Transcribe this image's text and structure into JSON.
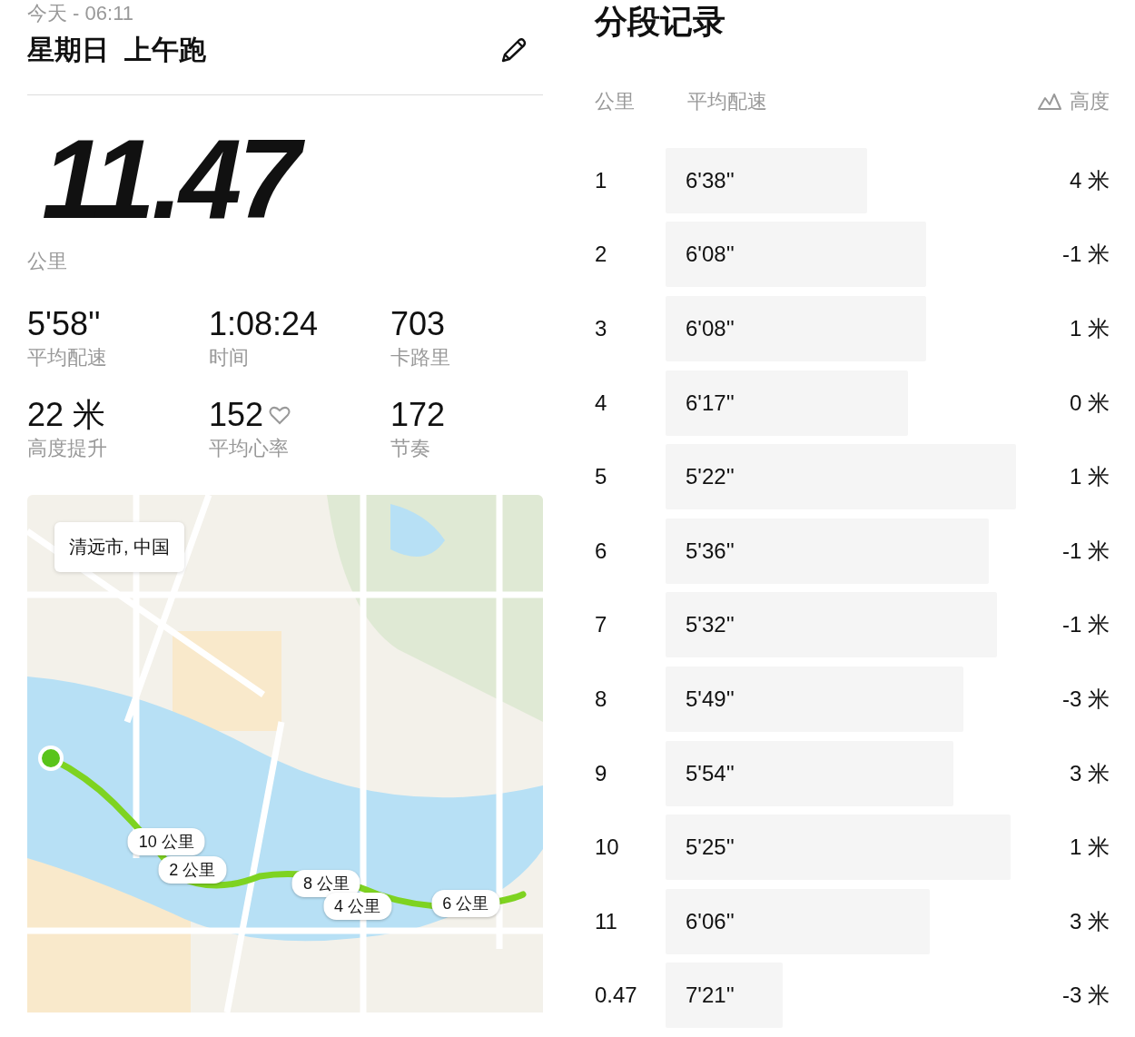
{
  "header": {
    "date": "今天 - 06:11",
    "title": "星期日  上午跑"
  },
  "distance": {
    "value": "11.47",
    "unit": "公里"
  },
  "stats": [
    {
      "value": "5'58''",
      "label": "平均配速",
      "kind": "plain"
    },
    {
      "value": "1:08:24",
      "label": "时间",
      "kind": "plain"
    },
    {
      "value": "703",
      "label": "卡路里",
      "kind": "plain"
    },
    {
      "value": "22 米",
      "label": "高度提升",
      "kind": "plain"
    },
    {
      "value": "152",
      "label": "平均心率",
      "kind": "heart"
    },
    {
      "value": "172",
      "label": "节奏",
      "kind": "plain"
    }
  ],
  "map": {
    "location": "清远市, 中国",
    "markers": [
      {
        "label": "10 公里"
      },
      {
        "label": "2 公里"
      },
      {
        "label": "8 公里"
      },
      {
        "label": "4 公里"
      },
      {
        "label": "6 公里"
      }
    ]
  },
  "splits": {
    "title": "分段记录",
    "columns": [
      "公里",
      "平均配速",
      "高度"
    ],
    "rows": [
      {
        "km": "1",
        "pace": "6'38''",
        "elevation": "4 米"
      },
      {
        "km": "2",
        "pace": "6'08''",
        "elevation": "-1 米"
      },
      {
        "km": "3",
        "pace": "6'08''",
        "elevation": "1 米"
      },
      {
        "km": "4",
        "pace": "6'17''",
        "elevation": "0 米"
      },
      {
        "km": "5",
        "pace": "5'22''",
        "elevation": "1 米"
      },
      {
        "km": "6",
        "pace": "5'36''",
        "elevation": "-1 米"
      },
      {
        "km": "7",
        "pace": "5'32''",
        "elevation": "-1 米"
      },
      {
        "km": "8",
        "pace": "5'49''",
        "elevation": "-3 米"
      },
      {
        "km": "9",
        "pace": "5'54''",
        "elevation": "3 米"
      },
      {
        "km": "10",
        "pace": "5'25''",
        "elevation": "1 米"
      },
      {
        "km": "11",
        "pace": "6'06''",
        "elevation": "3 米"
      },
      {
        "km": "0.47",
        "pace": "7'21''",
        "elevation": "-3 米"
      }
    ]
  }
}
